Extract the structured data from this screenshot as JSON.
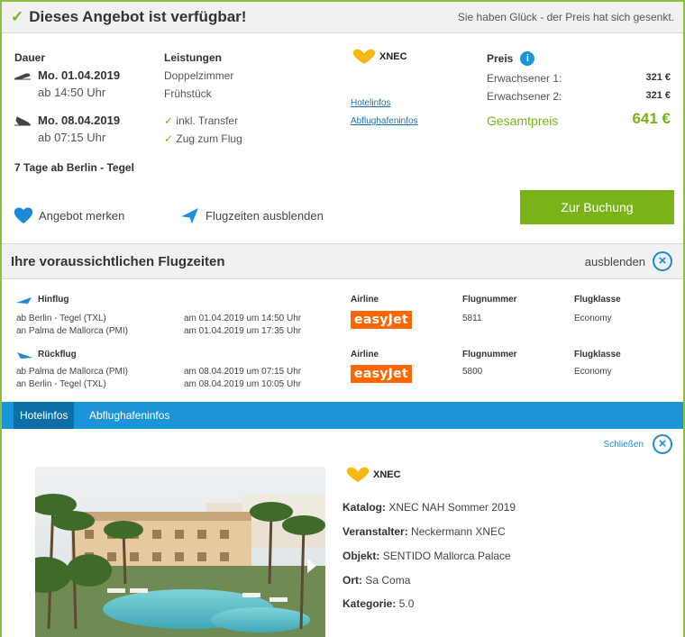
{
  "header": {
    "title": "Dieses Angebot ist verfügbar!",
    "note": "Sie haben Glück - der Preis hat sich gesenkt."
  },
  "offer": {
    "duration_label": "Dauer",
    "outbound_date": "Mo. 01.04.2019",
    "outbound_time": "ab 14:50 Uhr",
    "return_date": "Mo. 08.04.2019",
    "return_time": "ab 07:15 Uhr",
    "trip_summary": "7 Tage ab Berlin - Tegel",
    "services_label": "Leistungen",
    "service_room": "Doppelzimmer",
    "service_board": "Frühstück",
    "incl_transfer": "inkl. Transfer",
    "rail_to_flight": "Zug zum Flug",
    "brand": "XNEC",
    "hotel_info_link": "Hotelinfos",
    "airport_info_link": "Abflughafeninfos",
    "price_label": "Preis",
    "adult1_label": "Erwachsener 1:",
    "adult1_price": "321 €",
    "adult2_label": "Erwachsener 2:",
    "adult2_price": "321 €",
    "total_label": "Gesamtpreis",
    "total_price": "641 €",
    "remember_label": "Angebot merken",
    "hide_flights_label": "Flugzeiten ausblenden",
    "book_button": "Zur Buchung"
  },
  "flights": {
    "title": "Ihre voraussichtlichen Flugzeiten",
    "hide_label": "ausblenden",
    "col_airline": "Airline",
    "col_flightno": "Flugnummer",
    "col_class": "Flugklasse",
    "outbound": {
      "label": "Hinflug",
      "from": "ab Berlin - Tegel (TXL)",
      "to": "an Palma de Mallorca (PMI)",
      "dep": "am 01.04.2019 um 14:50 Uhr",
      "arr": "am 01.04.2019 um 17:35 Uhr",
      "airline": "easyJet",
      "flight_no": "5811",
      "class": "Economy"
    },
    "return": {
      "label": "Rückflug",
      "from": "ab Palma de Mallorca (PMI)",
      "to": "an Berlin - Tegel (TXL)",
      "dep": "am 08.04.2019 um 07:15 Uhr",
      "arr": "am 08.04.2019 um 10:05 Uhr",
      "airline": "easyJet",
      "flight_no": "5800",
      "class": "Economy"
    }
  },
  "tabs": [
    {
      "label": "Hotelinfos"
    },
    {
      "label": "Abflughafeninfos"
    }
  ],
  "hotel": {
    "close_label": "Schließen",
    "brand": "XNEC",
    "catalog_label": "Katalog:",
    "catalog": "XNEC NAH Sommer 2019",
    "operator_label": "Veranstalter:",
    "operator": "Neckermann XNEC",
    "object_label": "Objekt:",
    "object": "SENTIDO Mallorca Palace",
    "place_label": "Ort:",
    "place": "Sa Coma",
    "category_label": "Kategorie:",
    "category": "5.0"
  },
  "colors": {
    "accent_green": "#7ab317",
    "accent_blue": "#1b94d8",
    "easyjet_orange": "#ff6600",
    "xnec_yellow": "#f6b80f"
  }
}
